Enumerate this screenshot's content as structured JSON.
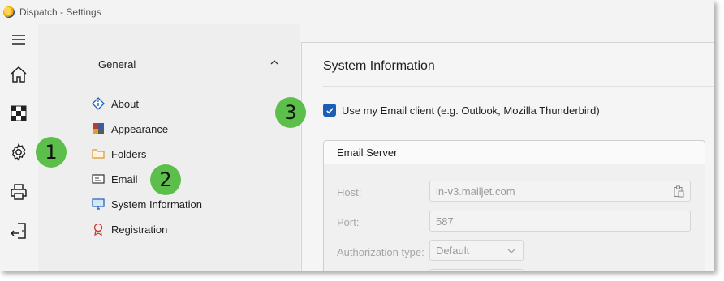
{
  "window": {
    "title": "Dispatch - Settings"
  },
  "rail": {
    "items": [
      {
        "name": "menu-icon"
      },
      {
        "name": "home-icon"
      },
      {
        "name": "checkerboard-icon"
      },
      {
        "name": "gear-icon"
      },
      {
        "name": "printer-icon"
      },
      {
        "name": "exit-door-icon"
      }
    ]
  },
  "nav": {
    "header": "General",
    "items": [
      {
        "label": "About",
        "icon": "info-diamond-icon"
      },
      {
        "label": "Appearance",
        "icon": "palette-grid-icon"
      },
      {
        "label": "Folders",
        "icon": "folder-icon"
      },
      {
        "label": "Email",
        "icon": "email-card-icon"
      },
      {
        "label": "System Information",
        "icon": "monitor-icon"
      },
      {
        "label": "Registration",
        "icon": "ribbon-icon"
      }
    ]
  },
  "callouts": [
    "1",
    "2",
    "3"
  ],
  "content": {
    "title": "System Information",
    "use_email_client": {
      "label": "Use my Email client (e.g. Outlook, Mozilla Thunderbird)",
      "checked": true
    },
    "email_server": {
      "header": "Email Server",
      "host_label": "Host:",
      "host_value": "in-v3.mailjet.com",
      "port_label": "Port:",
      "port_value": "587",
      "auth_label": "Authorization type:",
      "auth_value": "Default"
    }
  },
  "colors": {
    "accent": "#1a5fb4",
    "callout": "#5cbf4b"
  }
}
